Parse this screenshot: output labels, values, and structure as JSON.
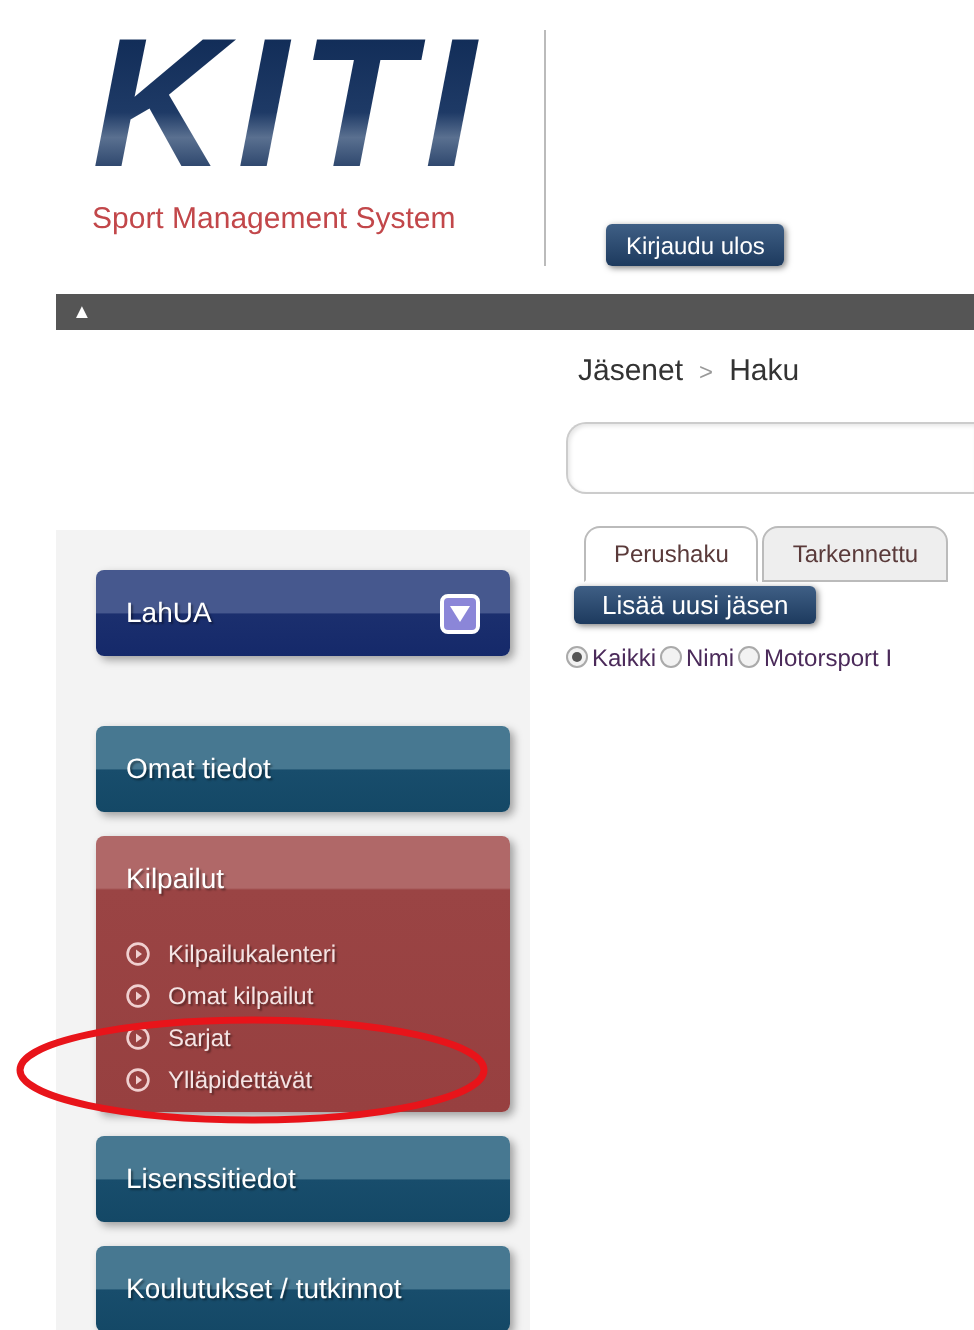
{
  "logo": {
    "wordmark": "KITI",
    "tagline": "Sport Management System"
  },
  "logout_button": "Kirjaudu ulos",
  "collapse_bar": {
    "toggle": "▲"
  },
  "sidebar": {
    "items": [
      {
        "label": "LahUA",
        "kind": "dropdown",
        "expanded": false
      },
      {
        "label": "Omat tiedot",
        "kind": "section",
        "expanded": false
      },
      {
        "label": "Kilpailut",
        "kind": "section",
        "expanded": true,
        "children": [
          {
            "label": "Kilpailukalenteri"
          },
          {
            "label": "Omat kilpailut"
          },
          {
            "label": "Sarjat"
          },
          {
            "label": "Ylläpidettävät"
          }
        ]
      },
      {
        "label": "Lisenssitiedot",
        "kind": "section",
        "expanded": false
      },
      {
        "label": "Koulutukset / tutkinnot",
        "kind": "section",
        "expanded": false
      }
    ]
  },
  "breadcrumb": [
    "Jäsenet",
    "Haku"
  ],
  "breadcrumb_separator": ">",
  "tabs": [
    {
      "label": "Perushaku",
      "selected": true
    },
    {
      "label": "Tarkennettu",
      "selected": false
    }
  ],
  "add_member_button": "Lisää uusi jäsen",
  "search_options": [
    {
      "label": "Kaikki",
      "selected": true
    },
    {
      "label": "Nimi",
      "selected": false
    },
    {
      "label": "Motorsport I",
      "selected": false
    }
  ]
}
